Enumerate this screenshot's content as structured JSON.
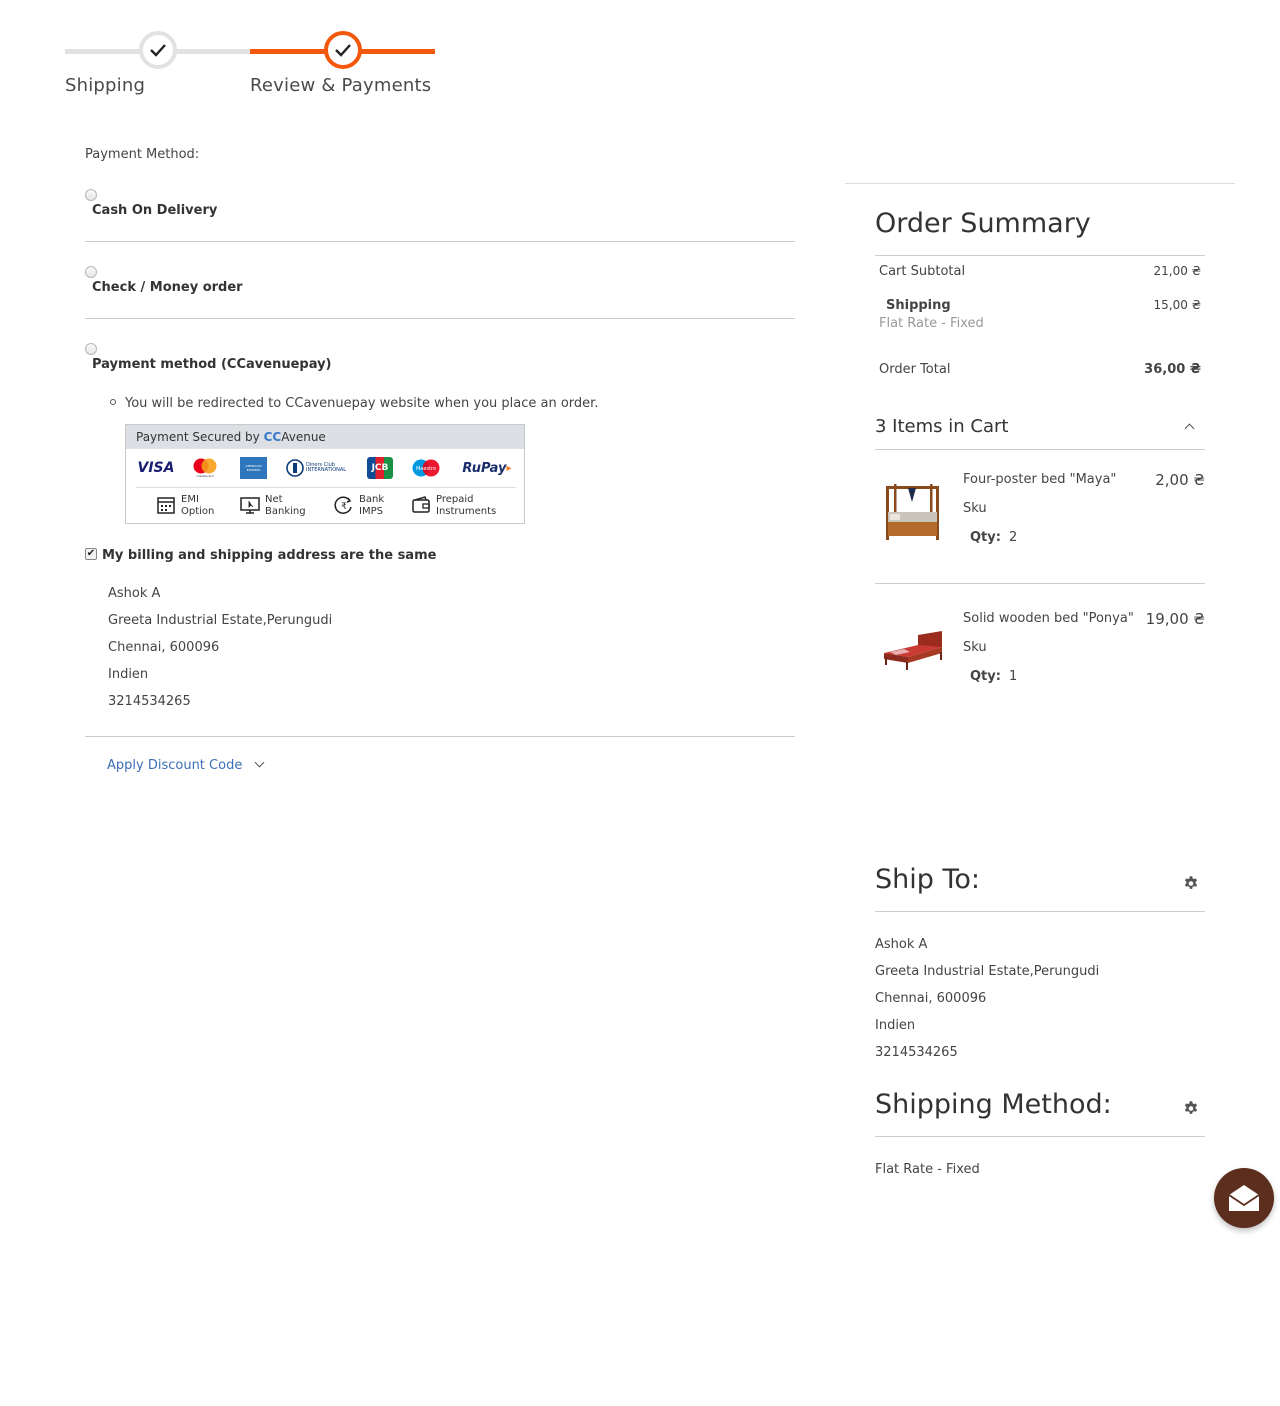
{
  "progress": {
    "steps": [
      {
        "label": "Shipping"
      },
      {
        "label": "Review & Payments"
      }
    ]
  },
  "payment": {
    "title": "Payment Method:",
    "methods": [
      {
        "label": "Cash On Delivery"
      },
      {
        "label": "Check / Money order"
      },
      {
        "label": "Payment method (CCavenuepay)"
      }
    ],
    "redirect_note": "You will be redirected to CCavenuepay website when you place an order.",
    "ccavenue": {
      "head_text": "Payment Secured by",
      "brand_cc": "CC",
      "brand_avenue": "Avenue",
      "cards": [
        "VISA",
        "mastercard",
        "AMERICAN EXPRESS",
        "Diners Club INTERNATIONAL",
        "JCB",
        "Maestro",
        "RuPay"
      ],
      "options": [
        {
          "line1": "EMI",
          "line2": "Option"
        },
        {
          "line1": "Net",
          "line2": "Banking"
        },
        {
          "line1": "Bank",
          "line2": "IMPS"
        },
        {
          "line1": "Prepaid",
          "line2": "Instruments"
        }
      ]
    },
    "same_address_label": "My billing and shipping address are the same",
    "same_address_checked": true,
    "billing_address": {
      "name": "Ashok A",
      "street": "Greeta Industrial Estate,Perungudi",
      "city": "Chennai, 600096",
      "country": "Indien",
      "phone": "3214534265"
    },
    "discount_label": "Apply Discount Code"
  },
  "summary": {
    "title": "Order Summary",
    "cart_subtotal_label": "Cart Subtotal",
    "cart_subtotal_value": "21,00 ₴",
    "shipping_label": "Shipping",
    "shipping_method": "Flat Rate - Fixed",
    "shipping_value": "15,00 ₴",
    "order_total_label": "Order Total",
    "order_total_value": "36,00 ₴",
    "items_title": "3 Items in Cart",
    "items": [
      {
        "name": "Four-poster bed \"Maya\"",
        "price": "2,00 ₴",
        "sku": "Sku",
        "qty_label": "Qty:",
        "qty": "2"
      },
      {
        "name": "Solid wooden bed \"Ponya\"",
        "price": "19,00 ₴",
        "sku": "Sku",
        "qty_label": "Qty:",
        "qty": "1"
      }
    ]
  },
  "ship_to": {
    "title": "Ship To:",
    "name": "Ashok A",
    "street": "Greeta Industrial Estate,Perungudi",
    "city": "Chennai, 600096",
    "country": "Indien",
    "phone": "3214534265"
  },
  "shipping_method": {
    "title": "Shipping Method:",
    "value": "Flat Rate - Fixed"
  },
  "colors": {
    "accent": "#f4580a",
    "link": "#3c6fb6",
    "fab": "#5b2e1d"
  }
}
